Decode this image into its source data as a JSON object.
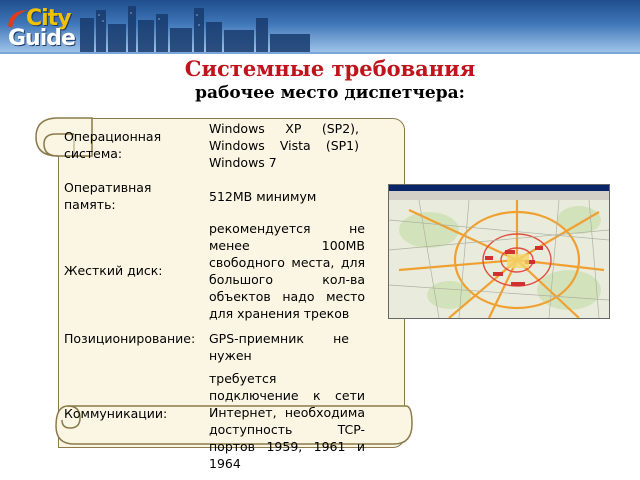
{
  "logo": {
    "part1": "City",
    "part2": "Guide"
  },
  "title": "Системные требования",
  "subtitle": "рабочее место диспетчера:",
  "requirements": [
    {
      "label": "Операционная система:",
      "value": "Windows XP (SP2), Windows Vista (SP1) Windows 7"
    },
    {
      "label": "Оперативная память:",
      "value": "512MB минимум"
    },
    {
      "label": "Жесткий диск:",
      "value": "рекомендуется не менее 100MB свободного места, для большого кол-ва объектов надо место для хранения треков"
    },
    {
      "label": "Позиционирование:",
      "value": "GPS-приемник не нужен"
    },
    {
      "label": "Коммуникации:",
      "value": "требуется подключение к сети Интернет, необходима доступность TCP-портов 1959, 1961 и 1964"
    }
  ],
  "colors": {
    "title": "#c0141c",
    "scroll_fill": "#fbf6e4",
    "scroll_border": "#8a7a4a",
    "banner": "#2f5f9e"
  }
}
